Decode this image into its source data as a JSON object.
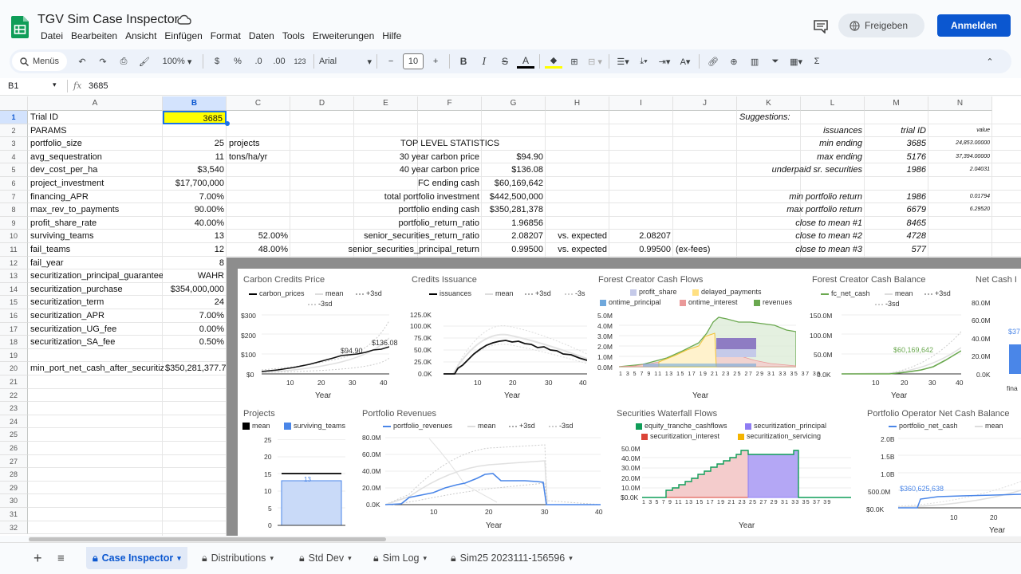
{
  "app": {
    "title": "TGV Sim Case Inspector",
    "share": "Freigeben",
    "signin": "Anmelden"
  },
  "menu": [
    "Datei",
    "Bearbeiten",
    "Ansicht",
    "Einfügen",
    "Format",
    "Daten",
    "Tools",
    "Erweiterungen",
    "Hilfe"
  ],
  "toolbar": {
    "menus": "Menüs",
    "zoom": "100%",
    "currency": "$",
    "percent": "%",
    "dec_less": ".0",
    "dec_more": ".00",
    "number": "123",
    "font": "Arial",
    "font_size": "10",
    "bold": "B",
    "italic": "I",
    "sum": "Σ"
  },
  "formula": {
    "cell_ref": "B1",
    "fx": "fx",
    "value": "3685"
  },
  "columns": [
    "A",
    "B",
    "C",
    "D",
    "E",
    "F",
    "G",
    "H",
    "I",
    "J",
    "K",
    "L",
    "M",
    "N"
  ],
  "rows": [
    "1",
    "2",
    "3",
    "4",
    "5",
    "6",
    "7",
    "8",
    "9",
    "10",
    "11",
    "12",
    "13",
    "14",
    "15",
    "16",
    "17",
    "18",
    "19",
    "20",
    "21",
    "22",
    "23",
    "24",
    "25",
    "26",
    "27",
    "28",
    "29",
    "30",
    "31",
    "32"
  ],
  "params": [
    {
      "a": "Trial ID",
      "b": "3685"
    },
    {
      "a": "PARAMS",
      "b": ""
    },
    {
      "a": "portfolio_size",
      "b": "25",
      "c": "projects"
    },
    {
      "a": "avg_sequestration",
      "b": "11",
      "c": "tons/ha/yr"
    },
    {
      "a": "dev_cost_per_ha",
      "b": "$3,540"
    },
    {
      "a": "project_investment",
      "b": "$17,700,000"
    },
    {
      "a": "financing_APR",
      "b": "7.00%"
    },
    {
      "a": "max_rev_to_payments",
      "b": "90.00%"
    },
    {
      "a": "profit_share_rate",
      "b": "40.00%"
    },
    {
      "a": "surviving_teams",
      "b": "13",
      "c": "52.00%"
    },
    {
      "a": "fail_teams",
      "b": "12",
      "c": "48.00%"
    },
    {
      "a": "fail_year",
      "b": "8"
    },
    {
      "a": "securitization_principal_guarantee",
      "b": "WAHR"
    },
    {
      "a": "securitization_purchase",
      "b": "$354,000,000"
    },
    {
      "a": "securitization_term",
      "b": "24"
    },
    {
      "a": "securitization_APR",
      "b": "7.00%"
    },
    {
      "a": "securitization_UG_fee",
      "b": "0.00%"
    },
    {
      "a": "securitization_SA_fee",
      "b": "0.50%"
    },
    {
      "a": "",
      "b": ""
    },
    {
      "a": "min_port_net_cash_after_securitiza",
      "b": "$350,281,377.77"
    }
  ],
  "stats": {
    "title": "TOP LEVEL STATISTICS",
    "rows": [
      {
        "label": "30 year carbon price",
        "value": "$94.90"
      },
      {
        "label": "40 year carbon price",
        "value": "$136.08"
      },
      {
        "label": "FC ending cash",
        "value": "$60,169,642"
      },
      {
        "label": "total portfolio investment",
        "value": "$442,500,000"
      },
      {
        "label": "portfolio ending cash",
        "value": "$350,281,378"
      },
      {
        "label": "portfolio_return_ratio",
        "value": "1.96856"
      },
      {
        "label": "senior_securities_return_ratio",
        "value": "2.08207",
        "h": "vs. expected",
        "i": "2.08207"
      },
      {
        "label": "senior_securities_principal_return",
        "value": "0.99500",
        "h": "vs. expected",
        "i": "0.99500",
        "j": "(ex-fees)"
      }
    ]
  },
  "suggestions": {
    "title": "Suggestions:",
    "head_l": "issuances",
    "head_m": "trial ID",
    "head_n": "value",
    "rows": [
      {
        "l": "min ending",
        "m": "3685",
        "n": "24,853.00000"
      },
      {
        "l": "max ending",
        "m": "5176",
        "n": "37,394.00000"
      },
      {
        "l": "underpaid sr. securities",
        "m": "1986",
        "n": "2.04031"
      },
      {
        "l": "",
        "m": "",
        "n": ""
      },
      {
        "l": "min portfolio return",
        "m": "1986",
        "n": "0.01794"
      },
      {
        "l": "max portfolio return",
        "m": "6679",
        "n": "6.29520"
      },
      {
        "l": "close to mean #1",
        "m": "8465",
        "n": ""
      },
      {
        "l": "close to mean #2",
        "m": "4728",
        "n": ""
      },
      {
        "l": "close to mean #3",
        "m": "577",
        "n": ""
      }
    ]
  },
  "charts": {
    "carbon": {
      "title": "Carbon Credits Price",
      "legend": [
        "carbon_prices",
        "mean",
        "+3sd",
        "-3sd"
      ],
      "xlabel": "Year",
      "yticks": [
        "$300",
        "$200",
        "$100",
        "$0"
      ],
      "xticks": [
        "10",
        "20",
        "30",
        "40"
      ],
      "ann1": "$94.90",
      "ann2": "$136.08"
    },
    "issuance": {
      "title": "Credits Issuance",
      "legend": [
        "issuances",
        "mean",
        "+3sd",
        "-3s"
      ],
      "xlabel": "Year",
      "yticks": [
        "125.0K",
        "100.0K",
        "75.0K",
        "50.0K",
        "25.0K",
        "0.0K"
      ],
      "xticks": [
        "10",
        "20",
        "30",
        "40"
      ]
    },
    "fccash": {
      "title": "Forest Creator Cash Flows",
      "legend": [
        "profit_share",
        "delayed_payments",
        "ontime_principal",
        "ontime_interest",
        "revenues"
      ],
      "xlabel": "Year",
      "yticks": [
        "5.0M",
        "4.0M",
        "3.0M",
        "2.0M",
        "1.0M",
        "0.0M"
      ]
    },
    "fcbal": {
      "title": "Forest Creator Cash Balance",
      "legend": [
        "fc_net_cash",
        "mean",
        "+3sd",
        "-3sd"
      ],
      "xlabel": "Year",
      "yticks": [
        "150.0M",
        "100.0M",
        "50.0M",
        "0.0K"
      ],
      "xticks": [
        "10",
        "20",
        "30",
        "40"
      ],
      "ann": "$60,169,642"
    },
    "netcash": {
      "title": "Net Cash I",
      "yticks": [
        "80.0M",
        "60.0M",
        "40.0M",
        "20.0M",
        "0.0K"
      ],
      "ann": "$37",
      "xlab": "fina"
    },
    "projects": {
      "title": "Projects",
      "legend": [
        "mean",
        "surviving_teams"
      ],
      "yticks": [
        "25",
        "20",
        "15",
        "10",
        "5",
        "0"
      ],
      "ann": "13"
    },
    "portrev": {
      "title": "Portfolio Revenues",
      "legend": [
        "portfolio_revenues",
        "mean",
        "+3sd",
        "-3sd"
      ],
      "xlabel": "Year",
      "yticks": [
        "80.0M",
        "60.0M",
        "40.0M",
        "20.0M",
        "0.0K"
      ],
      "xticks": [
        "10",
        "20",
        "30",
        "40"
      ]
    },
    "waterfall": {
      "title": "Securities Waterfall Flows",
      "legend": [
        "equity_tranche_cashflows",
        "securitization_principal",
        "securitization_interest",
        "securitization_servicing"
      ],
      "xlabel": "Year",
      "yticks": [
        "50.0M",
        "40.0M",
        "30.0M",
        "20.0M",
        "10.0M",
        "$0.0K"
      ]
    },
    "opnet": {
      "title": "Portfolio Operator Net Cash Balance",
      "legend": [
        "portfolio_net_cash",
        "mean"
      ],
      "xlabel": "Year",
      "yticks": [
        "2.0B",
        "1.5B",
        "1.0B",
        "500.0M",
        "$0.0K"
      ],
      "xticks": [
        "10",
        "20"
      ],
      "ann": "$360,625,638"
    }
  },
  "tabs": [
    "Case Inspector",
    "Distributions",
    "Std Dev",
    "Sim Log",
    "Sim25 2023111-156596"
  ],
  "colors": {
    "accent": "#0b57d0",
    "highlight": "#ffff00",
    "green": "#0f9d58"
  }
}
